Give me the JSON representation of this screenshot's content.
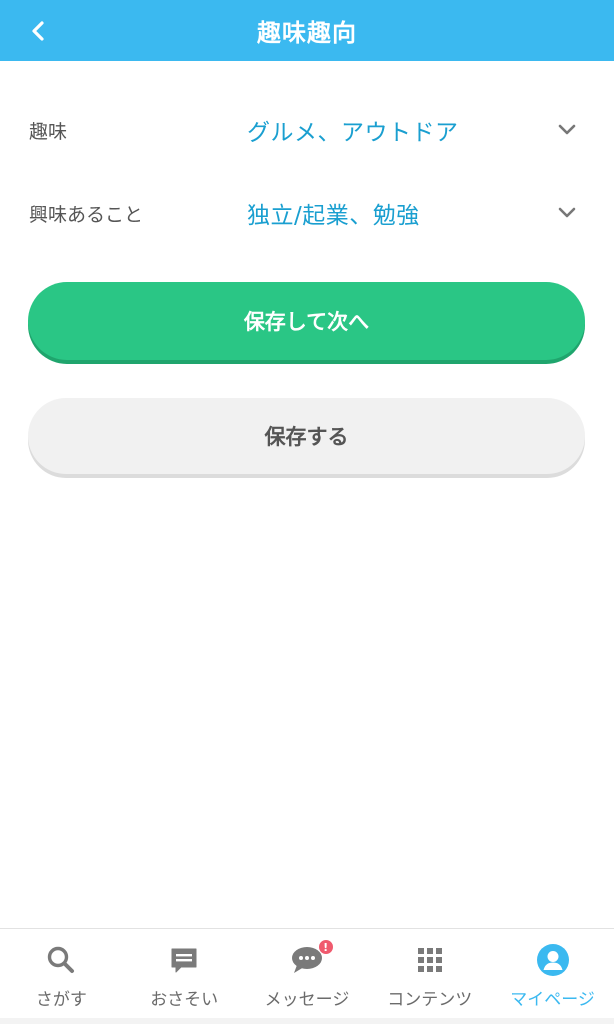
{
  "header": {
    "title": "趣味趣向",
    "back_icon": "chevron-left-icon"
  },
  "form": {
    "hobby": {
      "label": "趣味",
      "value": "グルメ、アウトドア"
    },
    "interest": {
      "label": "興味あること",
      "value": "独立/起業、勉強"
    }
  },
  "buttons": {
    "save_next": "保存して次へ",
    "save": "保存する"
  },
  "nav": {
    "items": [
      {
        "label": "さがす",
        "icon": "search-icon"
      },
      {
        "label": "おさそい",
        "icon": "invite-icon"
      },
      {
        "label": "メッセージ",
        "icon": "chat-icon",
        "badge": "!"
      },
      {
        "label": "コンテンツ",
        "icon": "grid-icon"
      },
      {
        "label": "マイページ",
        "icon": "user-icon",
        "active": true
      }
    ]
  },
  "colors": {
    "header": "#3bb9f0",
    "value_text": "#1a9fd0",
    "primary_button": "#2ac685",
    "secondary_button": "#f1f1f1",
    "active_nav": "#3bb9f0",
    "badge": "#f05a6e"
  }
}
